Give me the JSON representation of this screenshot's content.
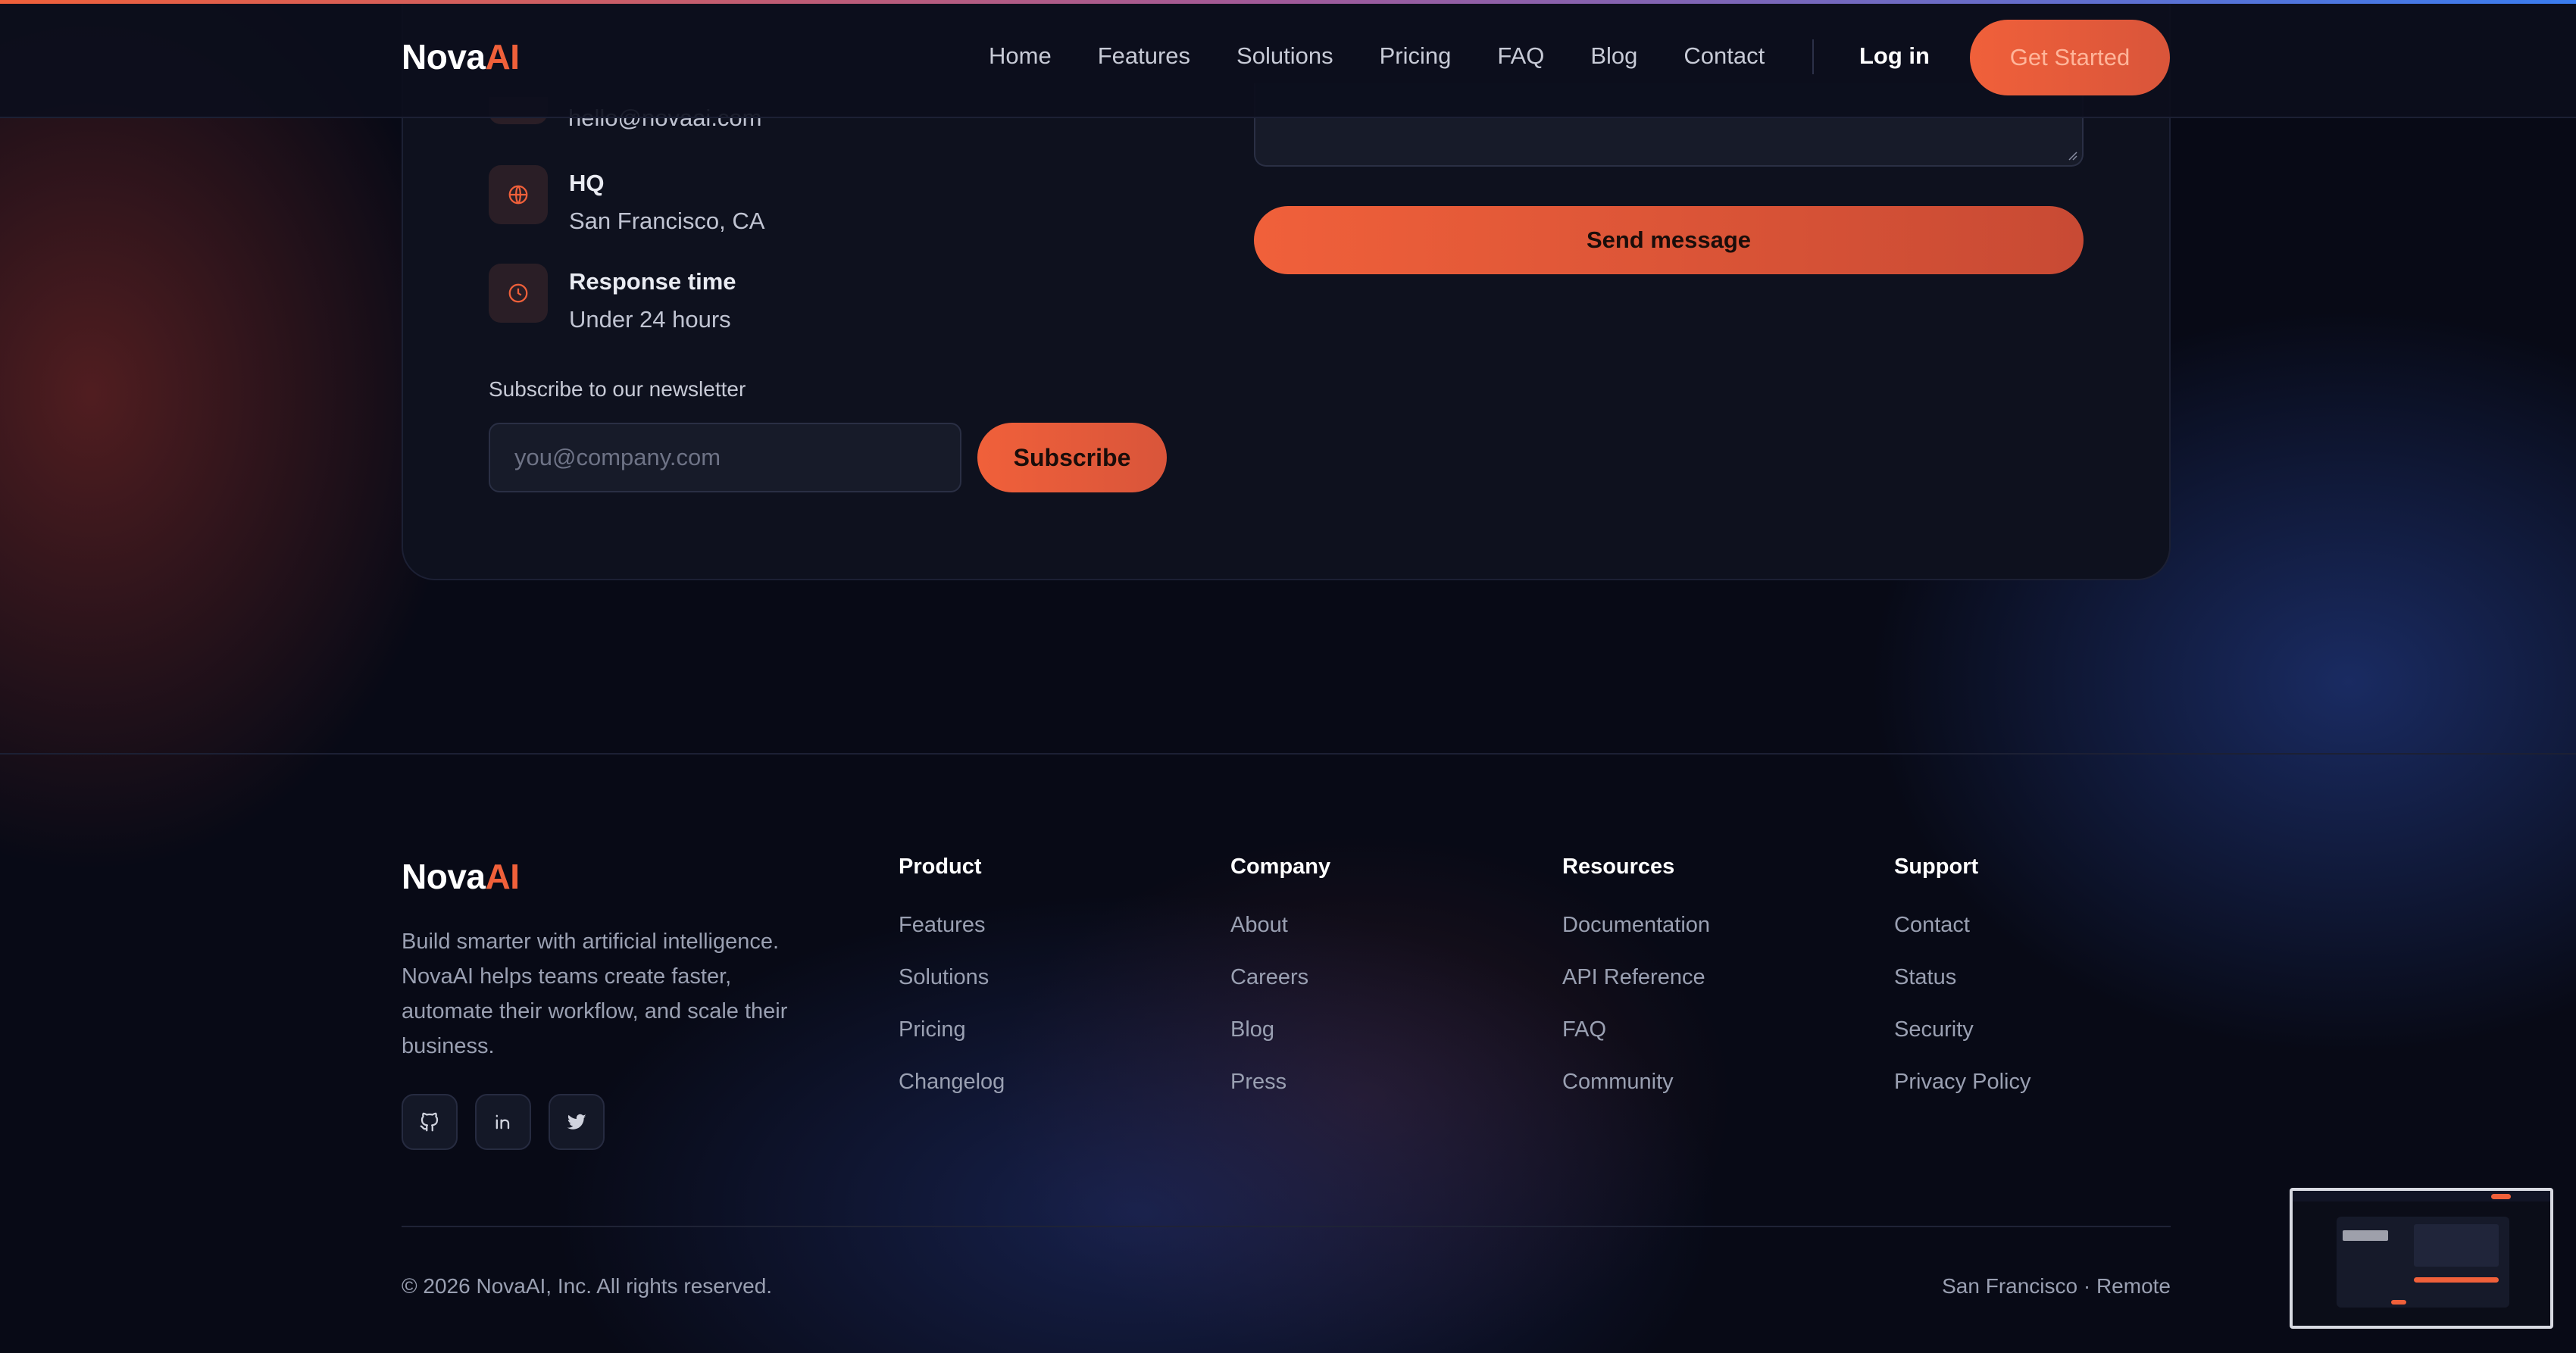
{
  "brand": {
    "name_prefix": "Nova",
    "name_suffix": "AI"
  },
  "colors": {
    "accent": "#f0603a",
    "background": "#080a16",
    "card": "#0e111e"
  },
  "nav": {
    "links": [
      "Home",
      "Features",
      "Solutions",
      "Pricing",
      "FAQ",
      "Blog",
      "Contact"
    ],
    "login_label": "Log in",
    "cta_label": "Get Started"
  },
  "contact": {
    "email": "hello@novaai.com",
    "items": [
      {
        "title": "HQ",
        "value": "San Francisco, CA",
        "icon": "globe-icon"
      },
      {
        "title": "Response time",
        "value": "Under 24 hours",
        "icon": "clock-icon"
      }
    ],
    "newsletter_label": "Subscribe to our newsletter",
    "newsletter_placeholder": "you@company.com",
    "subscribe_label": "Subscribe",
    "send_label": "Send message"
  },
  "footer": {
    "description": "Build smarter with artificial intelligence. NovaAI helps teams create faster, automate their workflow, and scale their business.",
    "socials": [
      "github-icon",
      "linkedin-icon",
      "twitter-icon"
    ],
    "columns": [
      {
        "title": "Product",
        "links": [
          "Features",
          "Solutions",
          "Pricing",
          "Changelog"
        ]
      },
      {
        "title": "Company",
        "links": [
          "About",
          "Careers",
          "Blog",
          "Press"
        ]
      },
      {
        "title": "Resources",
        "links": [
          "Documentation",
          "API Reference",
          "FAQ",
          "Community"
        ]
      },
      {
        "title": "Support",
        "links": [
          "Contact",
          "Status",
          "Security",
          "Privacy Policy"
        ]
      }
    ],
    "copyright": "© 2026 NovaAI, Inc. All rights reserved.",
    "locations": "San Francisco · Remote"
  }
}
